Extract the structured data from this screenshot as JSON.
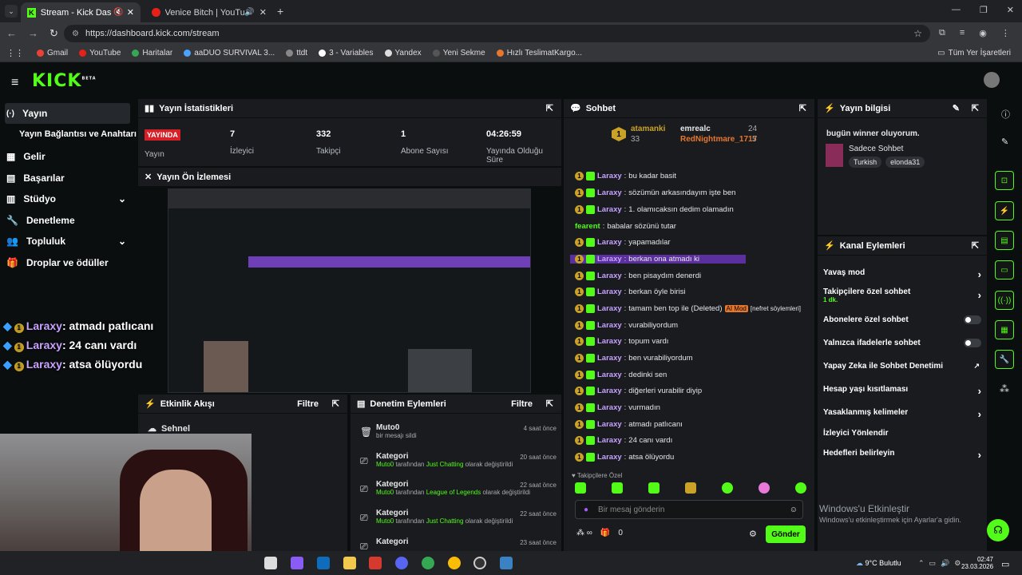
{
  "browser": {
    "tabs": [
      {
        "title": "Stream - Kick Dashboard"
      },
      {
        "title": "Venice Bitch | YouTube Mu"
      }
    ],
    "url": "https://dashboard.kick.com/stream",
    "bookmarks": [
      "Gmail",
      "YouTube",
      "Haritalar",
      "aaDUO SURVIVAL 3...",
      "ttdt",
      "3 - Variables",
      "Yandex",
      "Yeni Sekme",
      "Hızlı TeslimatKargo..."
    ],
    "bookmarks_right": "Tüm Yer İşaretleri"
  },
  "logo": "KICK",
  "logo_sup": "BETA",
  "nav": {
    "items": [
      "Yayın",
      "Yayın Bağlantısı ve Anahtarı",
      "Gelir",
      "Başarılar",
      "Stüdyo",
      "Denetleme",
      "Topluluk",
      "Droplar ve ödüller"
    ]
  },
  "stats": {
    "title": "Yayın İstatistikleri",
    "live": "YAYINDA",
    "live_label": "Yayın",
    "viewers": "7",
    "viewers_label": "İzleyici",
    "followers": "332",
    "followers_label": "Takipçi",
    "subs": "1",
    "subs_label": "Abone Sayısı",
    "uptime": "04:26:59",
    "uptime_label": "Yayında Olduğu Süre"
  },
  "preview": {
    "title": "Yayın Ön İzlemesi"
  },
  "activity": {
    "title": "Etkinlik Akışı",
    "filter": "Filtre",
    "item": "Sehnel"
  },
  "mod": {
    "title": "Denetim Eylemleri",
    "filter": "Filtre",
    "rows": [
      {
        "title": "Muto0",
        "desc": "bir mesajı sildi",
        "time": "4 saat önce"
      },
      {
        "title": "Kategori",
        "user": "Muto0",
        "mid": " tarafından ",
        "cat": "Just Chatting",
        "end": " olarak değiştirildi",
        "time": "20 saat önce"
      },
      {
        "title": "Kategori",
        "user": "Muto0",
        "mid": " tarafından ",
        "cat": "League of Legends",
        "end": " olarak değiştirildi",
        "time": "22 saat önce"
      },
      {
        "title": "Kategori",
        "user": "Muto0",
        "mid": " tarafından ",
        "cat": "Just Chatting",
        "end": " olarak değiştirildi",
        "time": "22 saat önce"
      },
      {
        "title": "Kategori",
        "time": "23 saat önce"
      }
    ]
  },
  "chat": {
    "title": "Sohbet",
    "top": [
      {
        "rank": "1",
        "name": "atamanki",
        "count": "33"
      },
      {
        "name": "emrealc",
        "count": "24"
      },
      {
        "name": "RedNightmare_1717",
        "count": "5"
      }
    ],
    "messages": [
      {
        "user": "Laraxy",
        "text": "bu kadar basit"
      },
      {
        "user": "Laraxy",
        "text": "sözümün arkasındayım işte ben"
      },
      {
        "user": "Laraxy",
        "text": "1. olamıcaksın dedim olamadın"
      },
      {
        "user": "fearent",
        "text": "babalar sözünü tutar",
        "plain": true
      },
      {
        "user": "Laraxy",
        "text": "yapamadılar"
      },
      {
        "user": "Laraxy",
        "text": "berkan ona atmadı ki"
      },
      {
        "user": "Laraxy",
        "text": "ben pisaydım denerdi"
      },
      {
        "user": "Laraxy",
        "text": "berkan öyle birisi"
      },
      {
        "user": "Laraxy",
        "text": "tamam ben top ile (Deleted)",
        "mod": "AI Mod",
        "extra": "[nefret söylemleri]"
      },
      {
        "user": "Laraxy",
        "text": "vurabiliyordum"
      },
      {
        "user": "Laraxy",
        "text": "topum vardı"
      },
      {
        "user": "Laraxy",
        "text": "ben vurabiliyordum"
      },
      {
        "user": "Laraxy",
        "text": "dedinki sen"
      },
      {
        "user": "Laraxy",
        "text": "diğerleri vurabilir diyip"
      },
      {
        "user": "Laraxy",
        "text": "vurmadın"
      },
      {
        "user": "Laraxy",
        "text": "atmadı patlıcanı"
      },
      {
        "user": "Laraxy",
        "text": "24 canı vardı"
      },
      {
        "user": "Laraxy",
        "text": "atsa ölüyordu"
      }
    ],
    "followers_only": "Takipçilere Özel",
    "placeholder": "Bir mesaj gönderin",
    "count": "0",
    "send": "Gönder"
  },
  "info": {
    "title": "Yayın bilgisi",
    "stream_title": "bugün winner oluyorum.",
    "category": "Sadece Sohbet",
    "tags": [
      "Turkish",
      "elonda31"
    ]
  },
  "actions": {
    "title": "Kanal Eylemleri",
    "rows": [
      {
        "label": "Yavaş mod",
        "ctl": "chevron"
      },
      {
        "label": "Takipçilere özel sohbet",
        "sub": "1 dk.",
        "ctl": "chevron"
      },
      {
        "label": "Abonelere özel sohbet",
        "ctl": "toggle"
      },
      {
        "label": "Yalnızca ifadelerle sohbet",
        "ctl": "toggle"
      },
      {
        "label": "Yapay Zeka ile Sohbet Denetimi",
        "ctl": "ext"
      },
      {
        "label": "Hesap yaşı kısıtlaması",
        "ctl": "chevron"
      },
      {
        "label": "Yasaklanmış kelimeler",
        "ctl": "chevron"
      },
      {
        "label": "İzleyici Yönlendir",
        "ctl": "none"
      },
      {
        "label": "Hedefleri belirleyin",
        "ctl": "chevron"
      }
    ]
  },
  "overlay": [
    {
      "user": "Laraxy",
      "text": ": atmadı patlıcanı"
    },
    {
      "user": "Laraxy",
      "text": ": 24 canı vardı"
    },
    {
      "user": "Laraxy",
      "text": ": atsa ölüyordu"
    }
  ],
  "watermark": {
    "title": "Windows'u Etkinleştir",
    "sub": "Windows'u etkinleştirmek için Ayarlar'a gidin."
  },
  "taskbar": {
    "weather": "9°C  Bulutlu",
    "time": "02:47",
    "date": "23.03.2026"
  },
  "colors": {
    "kick_green": "#53fc18",
    "panel": "#191b1f",
    "bg": "#0b0e0f",
    "username": "#c8a2ff",
    "live_red": "#d61f26"
  }
}
